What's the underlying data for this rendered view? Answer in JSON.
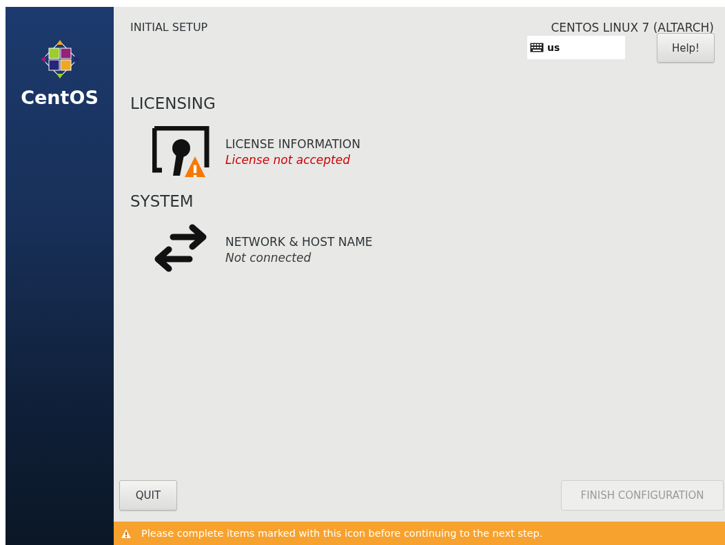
{
  "sidebar": {
    "logo_text": "CentOS"
  },
  "header": {
    "title": "INITIAL SETUP",
    "product": "CENTOS LINUX 7 (ALTARCH)",
    "keyboard_layout": "us",
    "help_button": "Help!"
  },
  "sections": [
    {
      "title": "LICENSING",
      "spokes": [
        {
          "kind": "license",
          "title": "LICENSE INFORMATION",
          "status": "License not accepted",
          "warning": true
        }
      ]
    },
    {
      "title": "SYSTEM",
      "spokes": [
        {
          "kind": "network",
          "title": "NETWORK & HOST NAME",
          "status": "Not connected",
          "warning": false
        }
      ]
    }
  ],
  "buttons": [
    {
      "kind": "quit",
      "label": "QUIT",
      "disabled": false
    },
    {
      "kind": "finish",
      "label": "FINISH CONFIGURATION",
      "disabled": true
    }
  ],
  "warning_bar": {
    "message": "Please complete items marked with this icon before continuing to the next step."
  }
}
